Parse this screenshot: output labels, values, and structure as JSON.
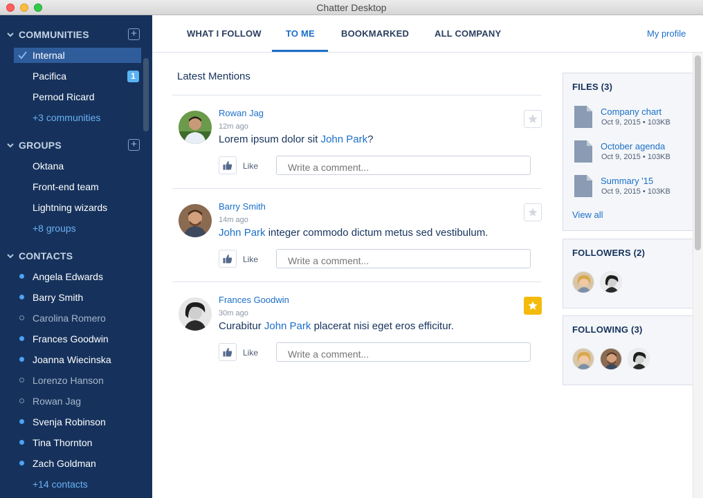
{
  "window": {
    "title": "Chatter Desktop"
  },
  "sidebar": {
    "communities": {
      "heading": "COMMUNITIES",
      "items": [
        {
          "label": "Internal",
          "active": true
        },
        {
          "label": "Pacifica",
          "badge": "1"
        },
        {
          "label": "Pernod Ricard"
        },
        {
          "label": "+3 communities",
          "more": true
        }
      ]
    },
    "groups": {
      "heading": "GROUPS",
      "items": [
        {
          "label": "Oktana"
        },
        {
          "label": "Front-end team"
        },
        {
          "label": "Lightning wizards"
        },
        {
          "label": "+8 groups",
          "more": true
        }
      ]
    },
    "contacts": {
      "heading": "CONTACTS",
      "items": [
        {
          "label": "Angela Edwards",
          "online": true
        },
        {
          "label": "Barry Smith",
          "online": true
        },
        {
          "label": "Carolina Romero",
          "online": false
        },
        {
          "label": "Frances Goodwin",
          "online": true
        },
        {
          "label": "Joanna Wiecinska",
          "online": true
        },
        {
          "label": "Lorenzo Hanson",
          "online": false
        },
        {
          "label": "Rowan Jag",
          "online": false
        },
        {
          "label": "Svenja Robinson",
          "online": true
        },
        {
          "label": "Tina Thornton",
          "online": true
        },
        {
          "label": "Zach Goldman",
          "online": true
        },
        {
          "label": "+14 contacts",
          "more": true
        }
      ]
    }
  },
  "nav": {
    "tabs": [
      {
        "label": "WHAT I FOLLOW"
      },
      {
        "label": "TO ME",
        "active": true
      },
      {
        "label": "BOOKMARKED"
      },
      {
        "label": "ALL COMPANY"
      }
    ],
    "profile_link": "My profile"
  },
  "feed": {
    "title": "Latest Mentions",
    "like_label": "Like",
    "comment_placeholder": "Write a comment...",
    "posts": [
      {
        "author": "Rowan Jag",
        "time": "12m ago",
        "before": "Lorem ipsum dolor sit ",
        "mention": "John Park",
        "after": "?",
        "starred": false
      },
      {
        "author": "Barry Smith",
        "time": "14m ago",
        "before": "",
        "mention": "John Park",
        "after": " integer commodo dictum metus sed vestibulum.",
        "starred": false
      },
      {
        "author": "Frances Goodwin",
        "time": "30m ago",
        "before": "Curabitur ",
        "mention": "John Park",
        "after": " placerat nisi eget eros efficitur.",
        "starred": true
      }
    ]
  },
  "panels": {
    "files": {
      "title": "FILES (3)",
      "items": [
        {
          "name": "Company chart",
          "meta": "Oct 9, 2015 • 103KB"
        },
        {
          "name": "October agenda",
          "meta": "Oct 9, 2015 • 103KB"
        },
        {
          "name": "Summary '15",
          "meta": "Oct 9, 2015 • 103KB"
        }
      ],
      "view_all": "View all"
    },
    "followers": {
      "title": "FOLLOWERS (2)"
    },
    "following": {
      "title": "FOLLOWING (3)"
    }
  },
  "colors": {
    "sidebar": "#16325c",
    "accent": "#1b6fc9",
    "star_on": "#f4bb0c",
    "online_dot": "#4fa2f5"
  }
}
